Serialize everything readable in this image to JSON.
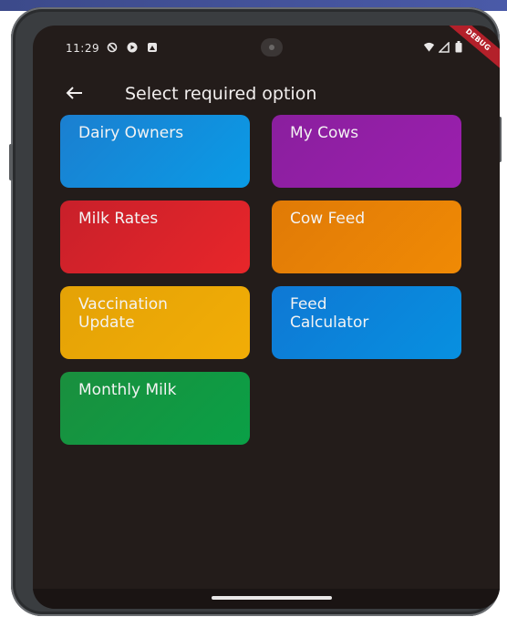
{
  "status_bar": {
    "time": "11:29",
    "icons": [
      "vpn-icon",
      "record-icon",
      "notification-icon",
      "wifi-icon",
      "signal-icon",
      "battery-icon"
    ]
  },
  "debug_banner": "DEBUG",
  "app_bar": {
    "back_icon": "arrow-left-icon",
    "title": "Select required option"
  },
  "tiles": [
    {
      "label": "Dairy Owners",
      "color_start": "#1b7fd0",
      "color_end": "#0a9be6"
    },
    {
      "label": "My Cows",
      "color_start": "#8a1f9e",
      "color_end": "#9b1fae"
    },
    {
      "label": "Milk Rates",
      "color_start": "#c8202a",
      "color_end": "#e8262a"
    },
    {
      "label": "Cow Feed",
      "color_start": "#e07a06",
      "color_end": "#f08a05"
    },
    {
      "label": "Vaccination\nUpdate",
      "color_start": "#e4a206",
      "color_end": "#f2ad06"
    },
    {
      "label": "Feed\nCalculator",
      "color_start": "#0f78d4",
      "color_end": "#0790e0"
    },
    {
      "label": "Monthly Milk",
      "color_start": "#1a8f3e",
      "color_end": "#0aa046"
    }
  ],
  "colors": {
    "screen_background": "#231c1a",
    "text": "#f2efee"
  }
}
